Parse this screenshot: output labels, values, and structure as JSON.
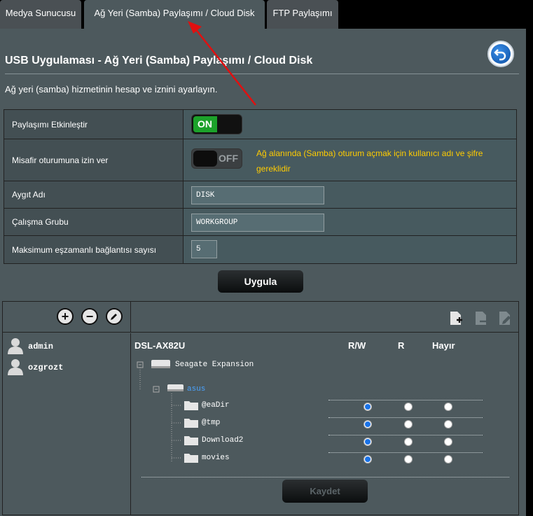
{
  "tabs": [
    {
      "label": "Medya Sunucusu"
    },
    {
      "label": "Ağ Yeri (Samba) Paylaşımı / Cloud Disk"
    },
    {
      "label": "FTP Paylaşımı"
    }
  ],
  "page": {
    "title": "USB Uygulaması - Ağ Yeri (Samba) Paylaşımı / Cloud Disk",
    "description": "Ağ yeri (samba) hizmetinin hesap ve iznini ayarlayın."
  },
  "settings": {
    "enable_sharing": {
      "label": "Paylaşımı Etkinleştir",
      "state": "ON"
    },
    "guest_login": {
      "label": "Misafir oturumuna izin ver",
      "state": "OFF",
      "note": "Ağ alanında (Samba) oturum açmak için kullanıcı adı ve şifre gereklidir"
    },
    "device_name": {
      "label": "Aygıt Adı",
      "value": "DISK"
    },
    "workgroup": {
      "label": "Çalışma Grubu",
      "value": "WORKGROUP"
    },
    "max_connections": {
      "label": "Maksimum eşzamanlı bağlantısı sayısı",
      "value": "5"
    }
  },
  "apply_label": "Uygula",
  "users": [
    {
      "name": "admin"
    },
    {
      "name": "ozgrozt"
    }
  ],
  "tree": {
    "device": "DSL-AX82U",
    "columns": [
      "R/W",
      "R",
      "Hayır"
    ],
    "disk": "Seagate Expansion",
    "share": "asus",
    "folders": [
      {
        "name": "@eaDir",
        "permission": "R/W"
      },
      {
        "name": "@tmp",
        "permission": "R/W"
      },
      {
        "name": "Download2",
        "permission": "R/W"
      },
      {
        "name": "movies",
        "permission": "R/W"
      }
    ]
  },
  "save_label": "Kaydet",
  "colors": {
    "accent_on": "#1ca12a",
    "warning": "#ffcc00",
    "annotation_arrow": "#e01010",
    "link": "#4aa3ff"
  }
}
